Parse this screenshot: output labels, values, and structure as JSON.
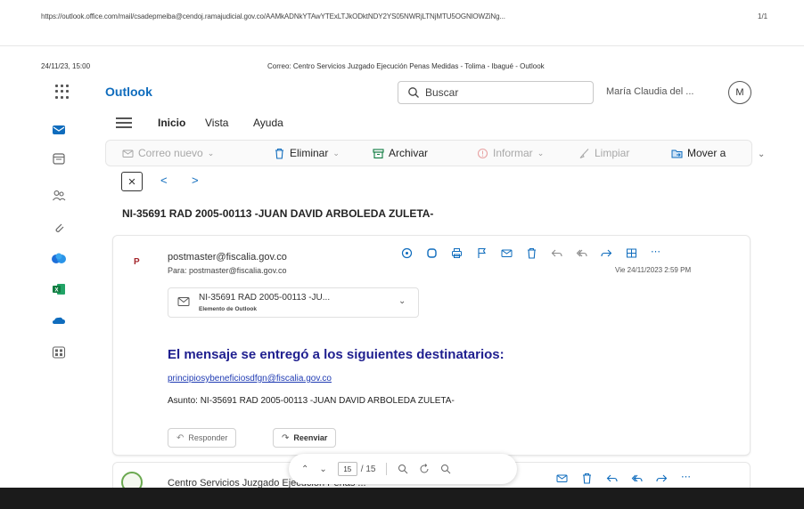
{
  "print_header": {
    "url": "https://outlook.office.com/mail/csadepmeiba@cendoj.ramajudicial.gov.co/AAMkADNkYTAwYTExLTJkODktNDY2YS05NWRjLTNjMTU5OGNlOWZiNg...",
    "page": "1/1",
    "date": "24/11/23, 15:00",
    "title": "Correo: Centro Servicios Juzgado Ejecución Penas Medidas - Tolima - Ibagué - Outlook"
  },
  "topbar": {
    "app_name": "Outlook",
    "search_placeholder": "Buscar",
    "user_name": "María Claudia del ...",
    "avatar_initial": "M"
  },
  "menu": {
    "tabs": [
      "Inicio",
      "Vista",
      "Ayuda"
    ]
  },
  "ribbon": {
    "new_mail": "Correo nuevo",
    "delete": "Eliminar",
    "archive": "Archivar",
    "report": "Informar",
    "sweep": "Limpiar",
    "move": "Mover a"
  },
  "message": {
    "subject": "NI-35691 RAD 2005-00113 -JUAN DAVID ARBOLEDA ZULETA-",
    "sender_initial": "P",
    "sender": "postmaster@fiscalia.gov.co",
    "to": "Para: postmaster@fiscalia.gov.co",
    "date": "Vie 24/11/2023 2:59 PM",
    "attachment_name": "NI-35691 RAD 2005-00113 -JU...",
    "attachment_type": "Elemento de Outlook",
    "ndr_heading": "El mensaje se entregó a los siguientes destinatarios:",
    "ndr_recipient": "principiosybeneficiosdfgn@fiscalia.gov.co",
    "ndr_subject": "Asunto: NI-35691 RAD 2005-00113 -JUAN DAVID ARBOLEDA ZULETA-",
    "reply": "Responder",
    "forward": "Reenviar"
  },
  "next_message": {
    "sender": "Centro Servicios Juzgado Ejecución Penas ..."
  },
  "pdf_toolbar": {
    "page_current": "15",
    "page_total": "/ 15"
  },
  "colors": {
    "brand": "#0f6cbd",
    "ndr_heading": "#1f1f8f",
    "link": "#1f3bb3"
  }
}
